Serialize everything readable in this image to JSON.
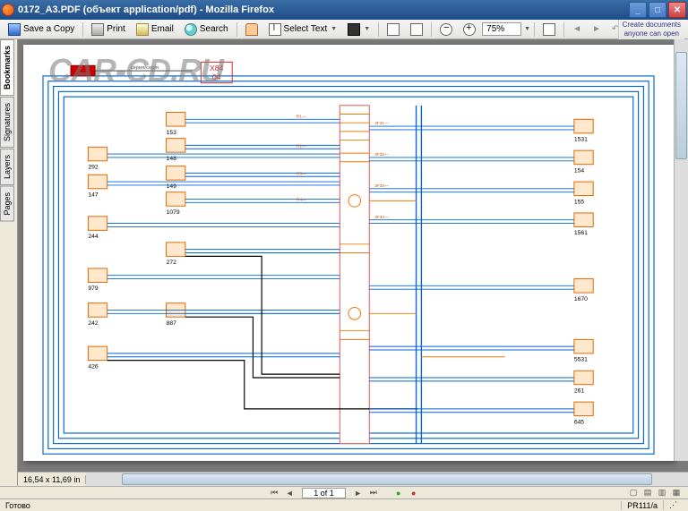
{
  "window": {
    "title": "0172_A3.PDF (объект application/pdf) - Mozilla Firefox"
  },
  "toolbar": {
    "save": "Save a Copy",
    "print": "Print",
    "email": "Email",
    "search": "Search",
    "select_text": "Select Text",
    "zoom": "75%"
  },
  "promo": {
    "line1": "Create documents",
    "line2": "anyone can open"
  },
  "sidebar": {
    "tabs": [
      "Bookmarks",
      "Signatures",
      "Layers",
      "Pages"
    ]
  },
  "page_info": {
    "dimensions": "16,54 x 11,69 in"
  },
  "nav": {
    "page_of": "1 of 1"
  },
  "status": {
    "ready": "Готово",
    "right": "PR111/a"
  },
  "diagram": {
    "watermark": "CAR-CD.RU",
    "header_box": "X84\n04",
    "header_sub": "серия/серія",
    "boxes_left": [
      "153",
      "292",
      "148",
      "149",
      "147",
      "1079",
      "244",
      "272",
      "979",
      "242",
      "887",
      "426"
    ],
    "boxes_right": [
      "1531",
      "154",
      "155",
      "1561",
      "1670",
      "5531",
      "261",
      "645"
    ]
  }
}
